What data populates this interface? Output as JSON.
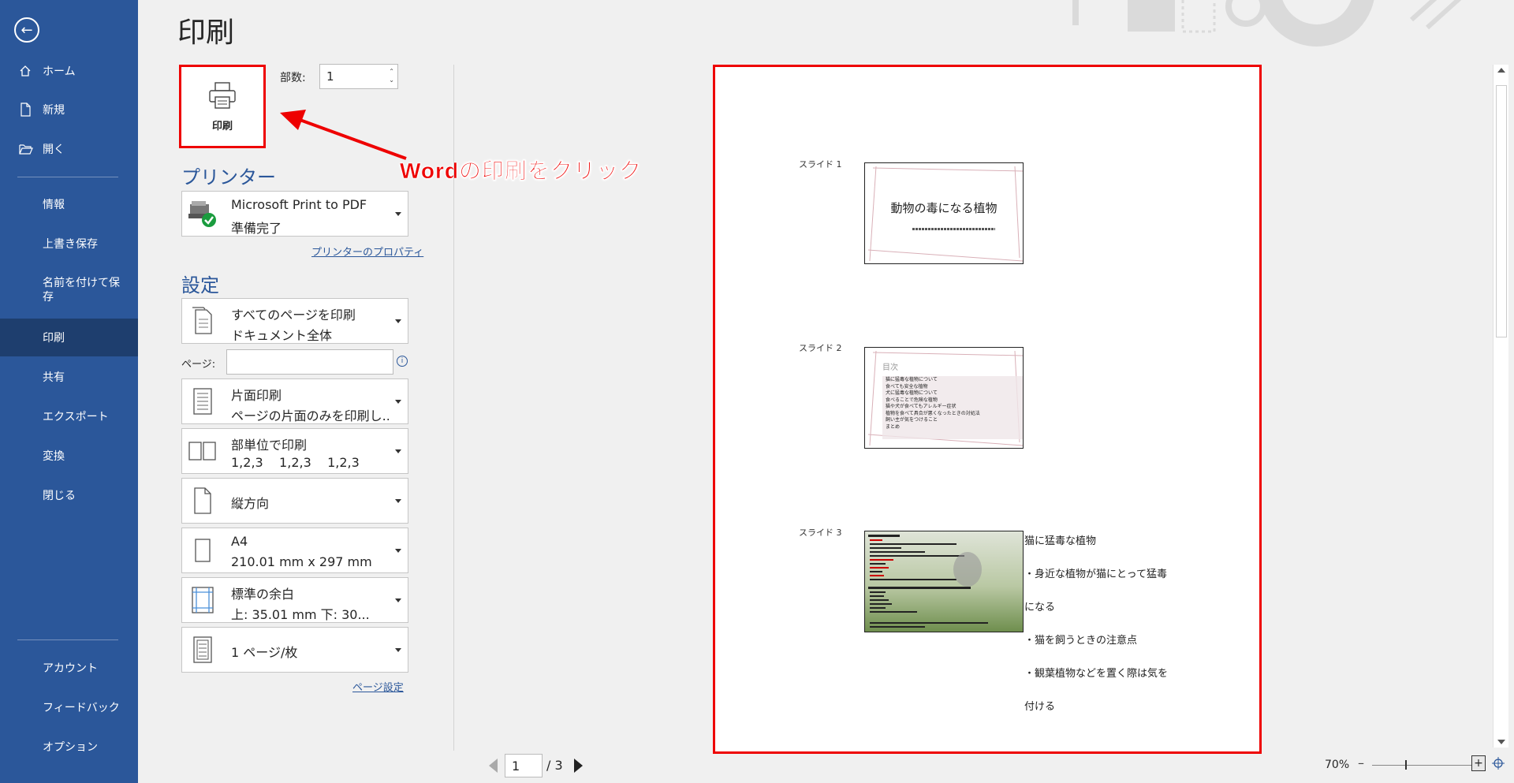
{
  "nav": {
    "back": "←",
    "top_items": [
      {
        "label": "ホーム",
        "icon": "home-icon"
      },
      {
        "label": "新規",
        "icon": "new-document-icon"
      },
      {
        "label": "開く",
        "icon": "open-folder-icon"
      }
    ],
    "items": [
      "情報",
      "上書き保存",
      "名前を付けて保存",
      "印刷",
      "共有",
      "エクスポート",
      "変換",
      "閉じる"
    ],
    "active": "印刷",
    "bottom_items": [
      "アカウント",
      "フィードバック",
      "オプション"
    ]
  },
  "header": {
    "title": "印刷"
  },
  "print": {
    "button_label": "印刷",
    "copies_label": "部数:",
    "copies_value": "1"
  },
  "printer": {
    "section_title": "プリンター",
    "name": "Microsoft Print to PDF",
    "status": "準備完了",
    "properties_link": "プリンターのプロパティ"
  },
  "settings": {
    "section_title": "設定",
    "range": {
      "line1": "すべてのページを印刷",
      "line2": "ドキュメント全体"
    },
    "pages_label": "ページ:",
    "pages_value": "",
    "info": "i",
    "sides": {
      "line1": "片面印刷",
      "line2": "ページの片面のみを印刷し..."
    },
    "collate": {
      "line1": "部単位で印刷",
      "line2": "1,2,3    1,2,3    1,2,3"
    },
    "orientation": {
      "line1": "縦方向"
    },
    "paper": {
      "line1": "A4",
      "line2": "210.01 mm x 297 mm"
    },
    "margins": {
      "line1": "標準の余白",
      "line2": "上: 35.01 mm 下: 30..."
    },
    "per_sheet": {
      "line1": "1 ページ/枚"
    },
    "page_setup_link": "ページ設定"
  },
  "annotation": {
    "text": "Wordの印刷をクリック",
    "color": "#e00000"
  },
  "preview": {
    "slides": [
      {
        "label": "スライド 1",
        "title": "動物の毒になる植物"
      },
      {
        "label": "スライド 2",
        "title": "目次"
      },
      {
        "label": "スライド 3"
      }
    ],
    "slide2_lines": [
      "猫に猛毒な植物について",
      "食べても安全な植物",
      "犬に猛毒な植物について",
      "食べることで危険な植物",
      "猫や犬が食べてもアレルギー症状",
      "植物を食べて具合が悪くなったときの対処法",
      "飼い主が気をつけること",
      "まとめ"
    ],
    "notes": [
      "猫に猛毒な植物",
      "・身近な植物が猫にとって猛毒",
      "になる",
      "・猫を飼うときの注意点",
      "・観葉植物などを置く際は気を",
      "付ける"
    ]
  },
  "footer": {
    "page_current": "1",
    "page_total": "/ 3",
    "zoom": "70%",
    "zoom_minus": "–",
    "zoom_plus": "+"
  },
  "colors": {
    "nav_bg": "#2b579a",
    "nav_active": "#1e3e6e",
    "accent": "#2b579a",
    "highlight": "#e00000"
  }
}
